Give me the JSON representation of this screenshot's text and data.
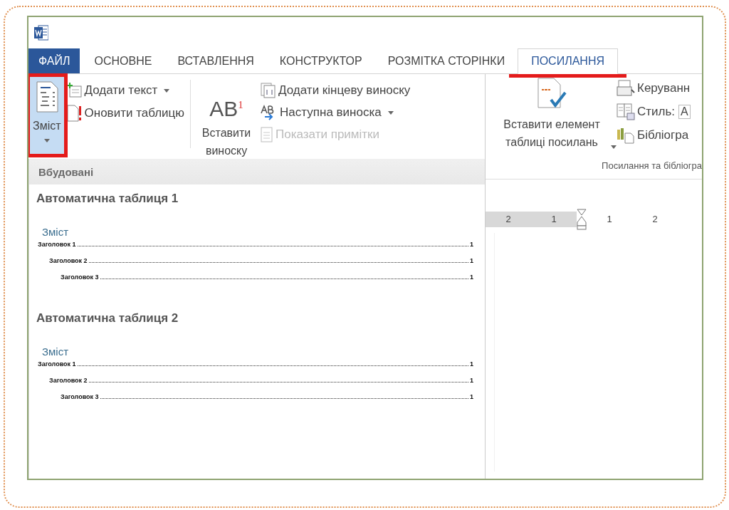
{
  "tabs": [
    {
      "label": "ФАЙЛ",
      "kind": "file",
      "selected": false
    },
    {
      "label": "ОСНОВНЕ",
      "kind": "tab",
      "selected": false
    },
    {
      "label": "ВСТАВЛЕННЯ",
      "kind": "tab",
      "selected": false
    },
    {
      "label": "КОНСТРУКТОР",
      "kind": "tab",
      "selected": false
    },
    {
      "label": "РОЗМІТКА СТОРІНКИ",
      "kind": "tab",
      "selected": false
    },
    {
      "label": "ПОСИЛАННЯ",
      "kind": "tab",
      "selected": true
    }
  ],
  "ribbon": {
    "groups": [
      {
        "big": {
          "label": "Зміст",
          "dropdown": true,
          "pressed": true,
          "highlighted": true
        },
        "small": [
          {
            "label": "Додати текст",
            "dropdown": true,
            "disabled": false
          },
          {
            "label": "Оновити таблицю",
            "dropdown": false,
            "disabled": false
          }
        ]
      },
      {
        "big": {
          "label": "Вставити виноску",
          "icon_text": "AB$^{1}$",
          "dropdown": false,
          "pressed": false,
          "highlighted": false
        },
        "small": [
          {
            "label": "Додати кінцеву виноску",
            "dropdown": false,
            "disabled": false
          },
          {
            "label": "Наступна виноска",
            "dropdown": true,
            "disabled": false
          },
          {
            "label": "Показати примітки",
            "dropdown": false,
            "disabled": true
          }
        ]
      },
      {
        "big": {
          "label": "Вставити елемент таблиці посилань",
          "dropdown": true,
          "pressed": false,
          "highlighted": false
        },
        "small": [
          {
            "label": "Керуванн",
            "dropdown": false,
            "disabled": false
          },
          {
            "label": "Стиль:",
            "value": "A",
            "dropdown": false,
            "disabled": false
          },
          {
            "label": "Бібліогра",
            "dropdown": false,
            "disabled": false
          }
        ],
        "group_label": "Посилання та бібліогра"
      }
    ]
  },
  "gallery": {
    "header": "Вбудовані",
    "items": [
      {
        "title": "Автоматична таблиця 1",
        "toc_title": "Зміст",
        "entries": [
          {
            "text": "Заголовок 1",
            "page": "1",
            "children": [
              {
                "text": "Заголовок 2",
                "page": "1",
                "children": [
                  {
                    "text": "Заголовок 3",
                    "page": "1"
                  }
                ]
              }
            ]
          }
        ]
      },
      {
        "title": "Автоматична таблиця 2",
        "toc_title": "Зміст",
        "entries": [
          {
            "text": "Заголовок 1",
            "page": "1",
            "children": [
              {
                "text": "Заголовок 2",
                "page": "1",
                "children": [
                  {
                    "text": "Заголовок 3",
                    "page": "1"
                  }
                ]
              }
            ]
          }
        ]
      }
    ]
  },
  "ruler": {
    "labels": [
      {
        "text": "2",
        "margin": true
      },
      {
        "text": "1",
        "margin": true
      },
      {
        "text": "1",
        "margin": false
      },
      {
        "text": "2",
        "margin": false
      }
    ]
  }
}
